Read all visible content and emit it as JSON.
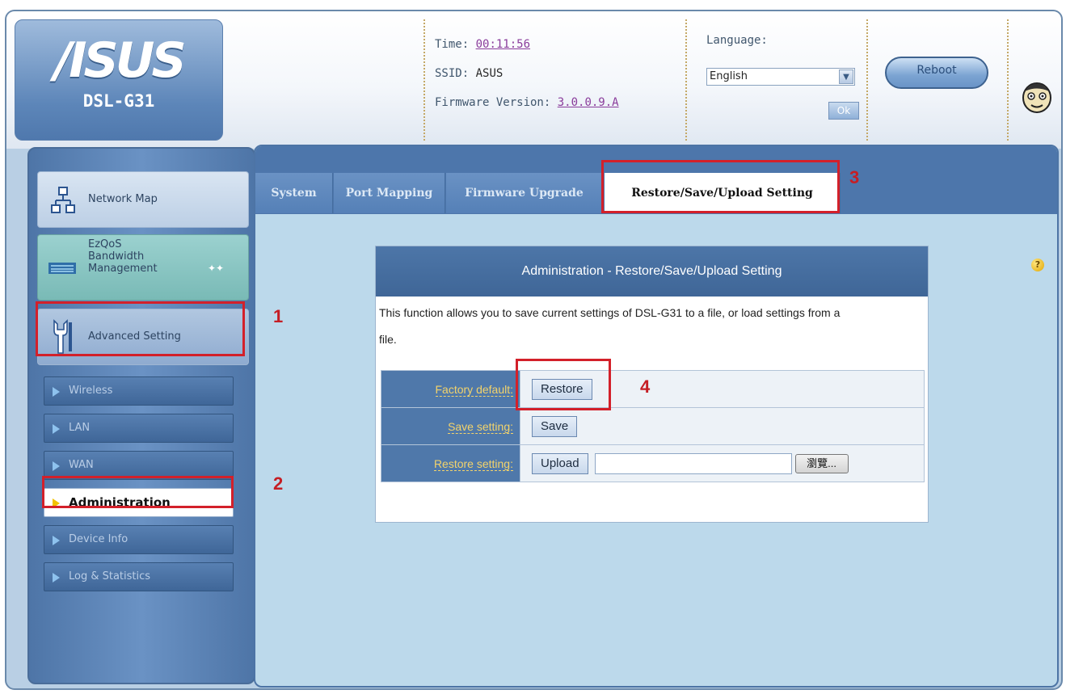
{
  "brand": {
    "logo": "/ISUS",
    "model": "DSL-G31"
  },
  "header": {
    "time_label": "Time:",
    "time_value": "00:11:56",
    "ssid_label": "SSID:",
    "ssid_value": "ASUS",
    "firmware_label": "Firmware Version:",
    "firmware_value": "3.0.0.9.A",
    "language_label": "Language:",
    "language_value": "English",
    "ok_label": "Ok",
    "reboot_label": "Reboot",
    "avatar_icon": "mascot-avatar-icon"
  },
  "sidebar": {
    "network_map": "Network Map",
    "ezqos": [
      "EzQoS",
      "Bandwidth",
      "Management"
    ],
    "advanced": "Advanced Setting",
    "items": [
      {
        "label": "Wireless"
      },
      {
        "label": "LAN"
      },
      {
        "label": "WAN"
      },
      {
        "label": "Administration"
      },
      {
        "label": "Device Info"
      },
      {
        "label": "Log & Statistics"
      }
    ]
  },
  "tabs": [
    {
      "label": "System"
    },
    {
      "label": "Port Mapping"
    },
    {
      "label": "Firmware Upgrade"
    },
    {
      "label": "Restore/Save/Upload Setting"
    }
  ],
  "admin": {
    "title": "Administration - Restore/Save/Upload Setting",
    "description_line1": "This function allows you to save current settings of DSL-G31 to a file, or load settings from a",
    "description_line2": "file.",
    "rows": [
      {
        "label": "Factory default:",
        "button": "Restore"
      },
      {
        "label": "Save setting:",
        "button": "Save"
      },
      {
        "label": "Restore setting:",
        "button": "Upload",
        "browse": "瀏覽..."
      }
    ]
  },
  "help_label": "?",
  "annotations": [
    "1",
    "2",
    "3",
    "4"
  ],
  "colors": {
    "annotation": "#d3202a",
    "tab_bar": "#4d76ab",
    "panel_bg": "#bcd9eb"
  }
}
